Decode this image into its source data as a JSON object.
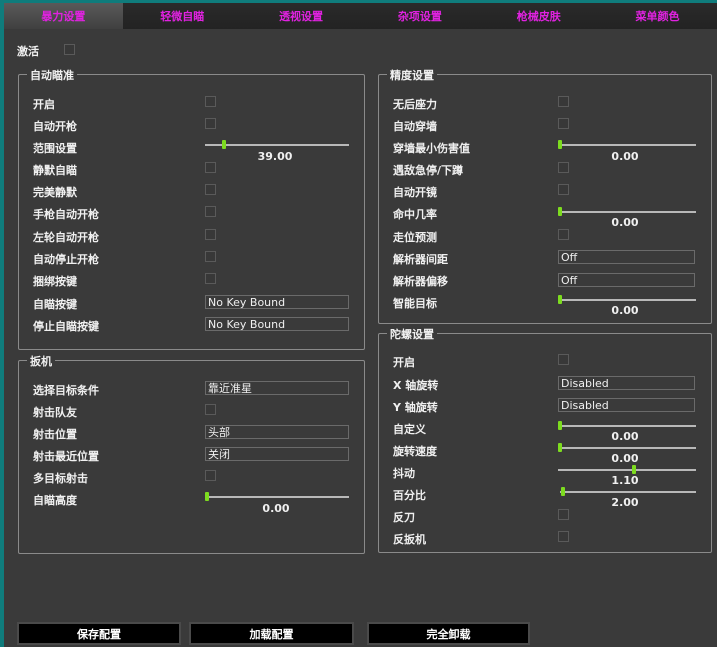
{
  "tabs": [
    {
      "label": "暴力设置",
      "active": true
    },
    {
      "label": "轻微自瞄",
      "active": false
    },
    {
      "label": "透视设置",
      "active": false
    },
    {
      "label": "杂项设置",
      "active": false
    },
    {
      "label": "枪械皮肤",
      "active": false
    },
    {
      "label": "菜单颜色",
      "active": false
    }
  ],
  "activate": {
    "label": "激活",
    "checked": false
  },
  "aimbot": {
    "title": "自动瞄准",
    "enable": "开启",
    "auto_fire": "自动开枪",
    "range": {
      "label": "范围设置",
      "value": "39.00",
      "fraction": 0.13
    },
    "silent": "静默自瞄",
    "perfect_silent": "完美静默",
    "pistol_auto_fire": "手枪自动开枪",
    "revolver_auto_fire": "左轮自动开枪",
    "auto_stop": "自动停止开枪",
    "bind_key": "捆绑按键",
    "aim_key": {
      "label": "自瞄按键",
      "value": "No Key Bound"
    },
    "stop_aim_key": {
      "label": "停止自瞄按键",
      "value": "No Key Bound"
    }
  },
  "trigger": {
    "title": "扳机",
    "target_condition": {
      "label": "选择目标条件",
      "value": "靠近准星"
    },
    "team_fire": "射击队友",
    "hit_position": {
      "label": "射击位置",
      "value": "头部"
    },
    "nearest_position": {
      "label": "射击最近位置",
      "value": "关闭"
    },
    "multi_target": "多目标射击",
    "aim_height": {
      "label": "自瞄高度",
      "value": "0.00",
      "fraction": 0.0
    }
  },
  "accuracy": {
    "title": "精度设置",
    "no_recoil": "无后座力",
    "auto_wall": "自动穿墙",
    "min_wall_damage": {
      "label": "穿墙最小伤害值",
      "value": "0.00",
      "fraction": 0.0
    },
    "stop_crouch": "遇敌急停/下蹲",
    "auto_scope": "自动开镜",
    "hit_chance": {
      "label": "命中几率",
      "value": "0.00",
      "fraction": 0.0
    },
    "prediction": "走位预测",
    "resolver_spacing": {
      "label": "解析器间距",
      "value": "Off"
    },
    "resolver_offset": {
      "label": "解析器偏移",
      "value": "Off"
    },
    "smart_target": {
      "label": "智能目标",
      "value": "0.00",
      "fraction": 0.0
    }
  },
  "gyro": {
    "title": "陀螺设置",
    "enable": "开启",
    "x_rotation": {
      "label": "X 轴旋转",
      "value": "Disabled"
    },
    "y_rotation": {
      "label": "Y 轴旋转",
      "value": "Disabled"
    },
    "custom": {
      "label": "自定义",
      "value": "0.00",
      "fraction": 0.0
    },
    "spin_speed": {
      "label": "旋转速度",
      "value": "0.00",
      "fraction": 0.0
    },
    "jitter": {
      "label": "抖动",
      "value": "1.10",
      "fraction": 0.55
    },
    "percent": {
      "label": "百分比",
      "value": "2.00",
      "fraction": 0.02
    },
    "anti_knife": "反刀",
    "anti_trigger": "反扳机"
  },
  "buttons": {
    "save": "保存配置",
    "load": "加载配置",
    "unload": "完全卸载"
  },
  "colors": {
    "accent_tab": "#e022e0",
    "slider_thumb": "#7ddc1f",
    "frame": "#0f7c7c"
  }
}
